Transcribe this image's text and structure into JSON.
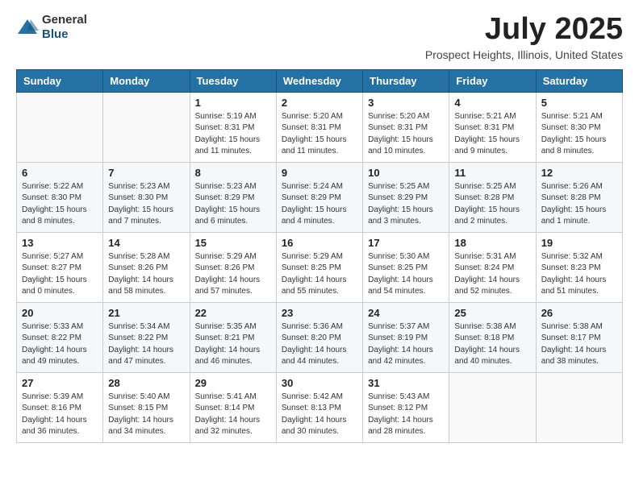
{
  "header": {
    "logo_line1": "General",
    "logo_line2": "Blue",
    "month_title": "July 2025",
    "location": "Prospect Heights, Illinois, United States"
  },
  "days_of_week": [
    "Sunday",
    "Monday",
    "Tuesday",
    "Wednesday",
    "Thursday",
    "Friday",
    "Saturday"
  ],
  "weeks": [
    [
      {
        "day": "",
        "info": ""
      },
      {
        "day": "",
        "info": ""
      },
      {
        "day": "1",
        "info": "Sunrise: 5:19 AM\nSunset: 8:31 PM\nDaylight: 15 hours and 11 minutes."
      },
      {
        "day": "2",
        "info": "Sunrise: 5:20 AM\nSunset: 8:31 PM\nDaylight: 15 hours and 11 minutes."
      },
      {
        "day": "3",
        "info": "Sunrise: 5:20 AM\nSunset: 8:31 PM\nDaylight: 15 hours and 10 minutes."
      },
      {
        "day": "4",
        "info": "Sunrise: 5:21 AM\nSunset: 8:31 PM\nDaylight: 15 hours and 9 minutes."
      },
      {
        "day": "5",
        "info": "Sunrise: 5:21 AM\nSunset: 8:30 PM\nDaylight: 15 hours and 8 minutes."
      }
    ],
    [
      {
        "day": "6",
        "info": "Sunrise: 5:22 AM\nSunset: 8:30 PM\nDaylight: 15 hours and 8 minutes."
      },
      {
        "day": "7",
        "info": "Sunrise: 5:23 AM\nSunset: 8:30 PM\nDaylight: 15 hours and 7 minutes."
      },
      {
        "day": "8",
        "info": "Sunrise: 5:23 AM\nSunset: 8:29 PM\nDaylight: 15 hours and 6 minutes."
      },
      {
        "day": "9",
        "info": "Sunrise: 5:24 AM\nSunset: 8:29 PM\nDaylight: 15 hours and 4 minutes."
      },
      {
        "day": "10",
        "info": "Sunrise: 5:25 AM\nSunset: 8:29 PM\nDaylight: 15 hours and 3 minutes."
      },
      {
        "day": "11",
        "info": "Sunrise: 5:25 AM\nSunset: 8:28 PM\nDaylight: 15 hours and 2 minutes."
      },
      {
        "day": "12",
        "info": "Sunrise: 5:26 AM\nSunset: 8:28 PM\nDaylight: 15 hours and 1 minute."
      }
    ],
    [
      {
        "day": "13",
        "info": "Sunrise: 5:27 AM\nSunset: 8:27 PM\nDaylight: 15 hours and 0 minutes."
      },
      {
        "day": "14",
        "info": "Sunrise: 5:28 AM\nSunset: 8:26 PM\nDaylight: 14 hours and 58 minutes."
      },
      {
        "day": "15",
        "info": "Sunrise: 5:29 AM\nSunset: 8:26 PM\nDaylight: 14 hours and 57 minutes."
      },
      {
        "day": "16",
        "info": "Sunrise: 5:29 AM\nSunset: 8:25 PM\nDaylight: 14 hours and 55 minutes."
      },
      {
        "day": "17",
        "info": "Sunrise: 5:30 AM\nSunset: 8:25 PM\nDaylight: 14 hours and 54 minutes."
      },
      {
        "day": "18",
        "info": "Sunrise: 5:31 AM\nSunset: 8:24 PM\nDaylight: 14 hours and 52 minutes."
      },
      {
        "day": "19",
        "info": "Sunrise: 5:32 AM\nSunset: 8:23 PM\nDaylight: 14 hours and 51 minutes."
      }
    ],
    [
      {
        "day": "20",
        "info": "Sunrise: 5:33 AM\nSunset: 8:22 PM\nDaylight: 14 hours and 49 minutes."
      },
      {
        "day": "21",
        "info": "Sunrise: 5:34 AM\nSunset: 8:22 PM\nDaylight: 14 hours and 47 minutes."
      },
      {
        "day": "22",
        "info": "Sunrise: 5:35 AM\nSunset: 8:21 PM\nDaylight: 14 hours and 46 minutes."
      },
      {
        "day": "23",
        "info": "Sunrise: 5:36 AM\nSunset: 8:20 PM\nDaylight: 14 hours and 44 minutes."
      },
      {
        "day": "24",
        "info": "Sunrise: 5:37 AM\nSunset: 8:19 PM\nDaylight: 14 hours and 42 minutes."
      },
      {
        "day": "25",
        "info": "Sunrise: 5:38 AM\nSunset: 8:18 PM\nDaylight: 14 hours and 40 minutes."
      },
      {
        "day": "26",
        "info": "Sunrise: 5:38 AM\nSunset: 8:17 PM\nDaylight: 14 hours and 38 minutes."
      }
    ],
    [
      {
        "day": "27",
        "info": "Sunrise: 5:39 AM\nSunset: 8:16 PM\nDaylight: 14 hours and 36 minutes."
      },
      {
        "day": "28",
        "info": "Sunrise: 5:40 AM\nSunset: 8:15 PM\nDaylight: 14 hours and 34 minutes."
      },
      {
        "day": "29",
        "info": "Sunrise: 5:41 AM\nSunset: 8:14 PM\nDaylight: 14 hours and 32 minutes."
      },
      {
        "day": "30",
        "info": "Sunrise: 5:42 AM\nSunset: 8:13 PM\nDaylight: 14 hours and 30 minutes."
      },
      {
        "day": "31",
        "info": "Sunrise: 5:43 AM\nSunset: 8:12 PM\nDaylight: 14 hours and 28 minutes."
      },
      {
        "day": "",
        "info": ""
      },
      {
        "day": "",
        "info": ""
      }
    ]
  ]
}
